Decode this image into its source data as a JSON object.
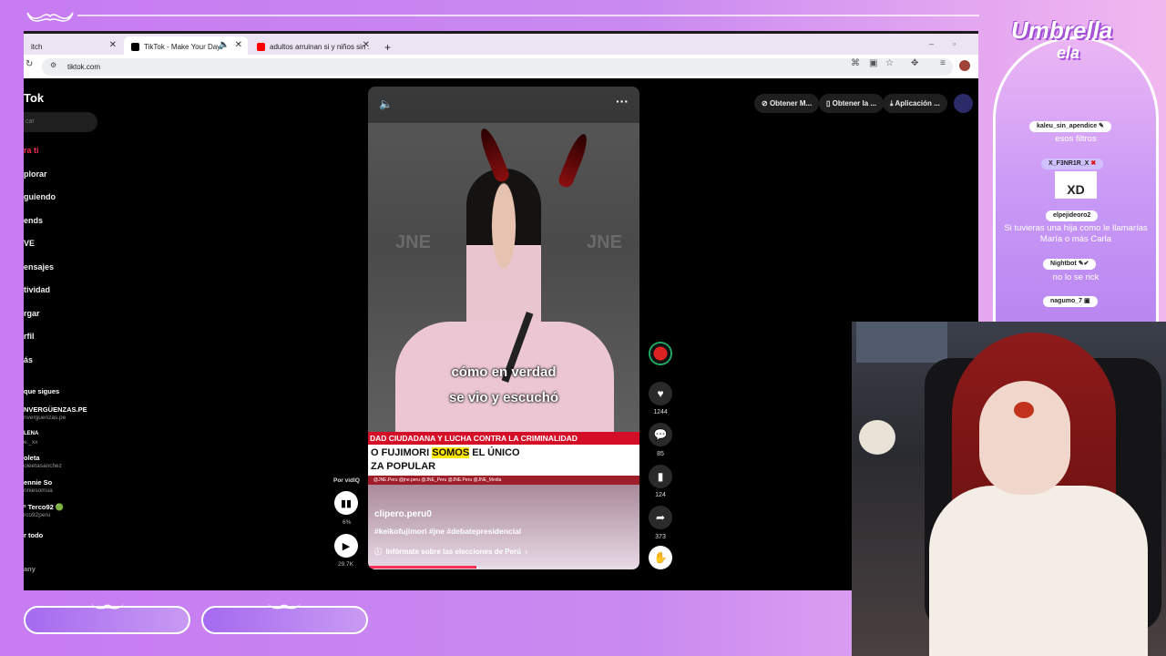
{
  "browser": {
    "tabs": [
      {
        "label": "itch",
        "active": false
      },
      {
        "label": "TikTok - Make Your Day",
        "active": true
      },
      {
        "label": "adultos arruinan si y niños sin ...",
        "active": false
      }
    ],
    "url": "tiktok.com"
  },
  "tiktok": {
    "logo": "Tok",
    "search_placeholder": "car",
    "nav": [
      "ra ti",
      "plorar",
      "guiendo",
      "ends",
      "VE",
      "ensajes",
      "tividad",
      "rgar",
      "rfil",
      "ás"
    ],
    "following_header": "que sigues",
    "following": [
      {
        "name": "NVERGÜENZAS.PE",
        "handle": "nverguenzas.pe"
      },
      {
        "name": "LENA",
        "handle": "e._xx"
      },
      {
        "name": "oleta",
        "handle": "oleetasanchez"
      },
      {
        "name": "ennie So",
        "handle": "nniesomua"
      },
      {
        "name": "² Terco92 🟢",
        "handle": "rco92peru"
      }
    ],
    "see_all": "r todo",
    "footer": "any",
    "top_buttons": [
      "Obtener M...",
      "Obtener la ...",
      "Aplicación ..."
    ],
    "video": {
      "caption_line1": "cómo en verdad",
      "caption_line2": "se vio y escuchó",
      "ticker_red": "DAD CIUDADANA Y LUCHA CONTRA LA CRIMINALIDAD",
      "ticker_main_a": "O FUJIMORI ",
      "ticker_main_hl": "SOMOS",
      "ticker_main_b": " EL ÚNICO",
      "ticker_main_line2": "ZA POPULAR",
      "ticker_small": "@JNE.Peru   @jne.peru   @JNE_Peru   @JNE.Peru   @JNE_Media",
      "author": "clipero.peru0",
      "hashtags": "#keikofujimori #jne #debatepresidencial",
      "election_link": "Infórmate sobre las elecciones de Perú",
      "progress": 0.4
    },
    "actions": {
      "likes": "1244",
      "comments": "85",
      "saves": "124",
      "shares": "373"
    },
    "left_controls": {
      "by": "Por vidIQ",
      "percent": "6%",
      "views": "29.7K"
    }
  },
  "chat": {
    "brand_top": "Umbrella",
    "brand_bottom": "ela",
    "messages": [
      {
        "user": "kaleu_sin_apendice",
        "text": "esos filtros"
      },
      {
        "user": "X_F3NR1R_X",
        "text": "XD"
      },
      {
        "user": "elpejideoro2",
        "text": "Si tuvieras una hija como le llamarías María o más Carla"
      },
      {
        "user": "Nightbot",
        "text": "no lo se rick"
      },
      {
        "user": "nagumo_7",
        "text": ""
      }
    ]
  },
  "colors": {
    "tiktok_red": "#fe2c55",
    "overlay_purple": "#c77bf2"
  }
}
